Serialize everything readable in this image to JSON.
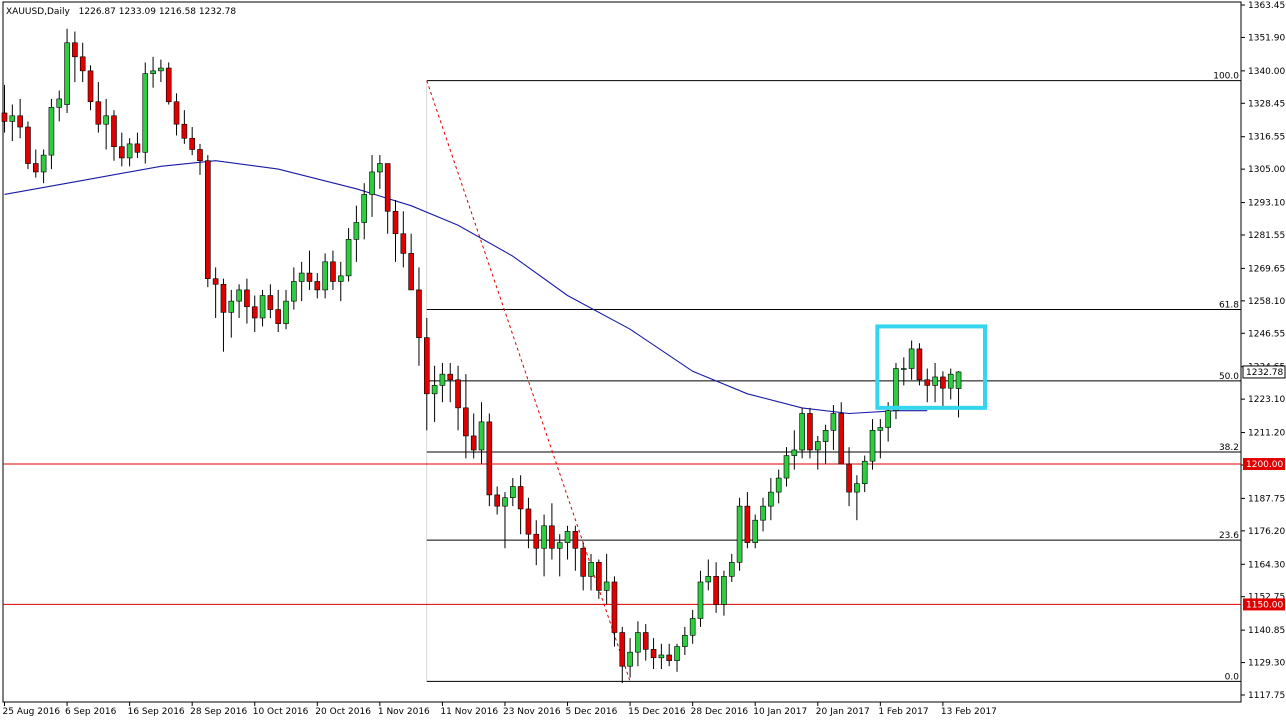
{
  "header": {
    "symbol": "XAUUSD,Daily",
    "ohlc": "1226.87 1233.09 1216.58 1232.78"
  },
  "colors": {
    "bull": "#2ecc40",
    "bear": "#e00000",
    "wick": "#000000",
    "ma": "#1a1aa6",
    "hline_red": "#e00000",
    "fib_line": "#000000",
    "fib_trend": "#e00000",
    "box": "#33d6ee",
    "price_tag_bg": "#ffffff",
    "red_tag_bg": "#e00000"
  },
  "chart_data": {
    "type": "candlestick",
    "symbol": "XAUUSD",
    "timeframe": "Daily",
    "ylim": [
      1117.75,
      1363.45
    ],
    "y_ticks": [
      "1363.45",
      "1351.90",
      "1340.00",
      "1328.45",
      "1316.55",
      "1305.00",
      "1293.10",
      "1281.55",
      "1269.65",
      "1258.10",
      "1246.55",
      "1234.65",
      "1223.10",
      "1211.20",
      "1199.65",
      "1187.75",
      "1176.20",
      "1164.30",
      "1152.75",
      "1140.85",
      "1129.30",
      "1117.75"
    ],
    "x_labels": [
      "25 Aug 2016",
      "6 Sep 2016",
      "16 Sep 2016",
      "28 Sep 2016",
      "10 Oct 2016",
      "20 Oct 2016",
      "1 Nov 2016",
      "11 Nov 2016",
      "23 Nov 2016",
      "5 Dec 2016",
      "15 Dec 2016",
      "28 Dec 2016",
      "10 Jan 2017",
      "20 Jan 2017",
      "1 Feb 2017",
      "13 Feb 2017"
    ],
    "x_label_index": [
      0,
      8,
      16,
      24,
      32,
      40,
      48,
      56,
      64,
      72,
      80,
      88,
      96,
      104,
      112,
      120
    ],
    "candles": [
      [
        1325,
        1335,
        1318,
        1322
      ],
      [
        1322,
        1328,
        1315,
        1324
      ],
      [
        1324,
        1330,
        1316,
        1320
      ],
      [
        1320,
        1322,
        1305,
        1307
      ],
      [
        1307,
        1312,
        1302,
        1304
      ],
      [
        1304,
        1312,
        1300,
        1310
      ],
      [
        1310,
        1330,
        1305,
        1327
      ],
      [
        1327,
        1333,
        1322,
        1330
      ],
      [
        1328,
        1355,
        1325,
        1350
      ],
      [
        1350,
        1354,
        1336,
        1345
      ],
      [
        1345,
        1350,
        1336,
        1340
      ],
      [
        1340,
        1342,
        1326,
        1329
      ],
      [
        1329,
        1336,
        1318,
        1321
      ],
      [
        1321,
        1330,
        1312,
        1324
      ],
      [
        1324,
        1326,
        1308,
        1313
      ],
      [
        1313,
        1318,
        1306,
        1309
      ],
      [
        1309,
        1316,
        1306,
        1314
      ],
      [
        1314,
        1318,
        1309,
        1311
      ],
      [
        1311,
        1343,
        1307,
        1339
      ],
      [
        1339,
        1345,
        1334,
        1340
      ],
      [
        1340,
        1344,
        1336,
        1341
      ],
      [
        1341,
        1343,
        1328,
        1329
      ],
      [
        1329,
        1332,
        1317,
        1321
      ],
      [
        1321,
        1326,
        1314,
        1316
      ],
      [
        1316,
        1320,
        1310,
        1312
      ],
      [
        1312,
        1314,
        1303,
        1308
      ],
      [
        1308,
        1310,
        1263,
        1266
      ],
      [
        1266,
        1270,
        1252,
        1264
      ],
      [
        1264,
        1266,
        1240,
        1254
      ],
      [
        1254,
        1262,
        1245,
        1258
      ],
      [
        1258,
        1264,
        1252,
        1262
      ],
      [
        1262,
        1266,
        1250,
        1256
      ],
      [
        1256,
        1260,
        1247,
        1252
      ],
      [
        1252,
        1262,
        1249,
        1260
      ],
      [
        1260,
        1264,
        1252,
        1255
      ],
      [
        1255,
        1262,
        1247,
        1250
      ],
      [
        1250,
        1262,
        1248,
        1258
      ],
      [
        1258,
        1270,
        1255,
        1265
      ],
      [
        1265,
        1272,
        1258,
        1268
      ],
      [
        1268,
        1276,
        1262,
        1265
      ],
      [
        1265,
        1268,
        1259,
        1262
      ],
      [
        1262,
        1275,
        1259,
        1272
      ],
      [
        1272,
        1276,
        1262,
        1265
      ],
      [
        1265,
        1272,
        1258,
        1267
      ],
      [
        1267,
        1284,
        1265,
        1280
      ],
      [
        1280,
        1292,
        1272,
        1286
      ],
      [
        1286,
        1300,
        1280,
        1296
      ],
      [
        1296,
        1310,
        1288,
        1304
      ],
      [
        1304,
        1310,
        1298,
        1307
      ],
      [
        1307,
        1304,
        1282,
        1290
      ],
      [
        1290,
        1294,
        1272,
        1282
      ],
      [
        1282,
        1290,
        1270,
        1275
      ],
      [
        1275,
        1282,
        1262,
        1262
      ],
      [
        1262,
        1270,
        1235,
        1245
      ],
      [
        1245,
        1252,
        1212,
        1225
      ],
      [
        1225,
        1235,
        1215,
        1228
      ],
      [
        1228,
        1236,
        1222,
        1232
      ],
      [
        1232,
        1236,
        1222,
        1230
      ],
      [
        1230,
        1235,
        1212,
        1220
      ],
      [
        1220,
        1232,
        1202,
        1210
      ],
      [
        1210,
        1218,
        1202,
        1205
      ],
      [
        1205,
        1222,
        1200,
        1215
      ],
      [
        1215,
        1218,
        1185,
        1189
      ],
      [
        1189,
        1192,
        1182,
        1185
      ],
      [
        1185,
        1190,
        1170,
        1188
      ],
      [
        1188,
        1195,
        1185,
        1192
      ],
      [
        1192,
        1196,
        1175,
        1184
      ],
      [
        1184,
        1188,
        1170,
        1175
      ],
      [
        1175,
        1180,
        1164,
        1170
      ],
      [
        1170,
        1182,
        1160,
        1178
      ],
      [
        1178,
        1186,
        1166,
        1170
      ],
      [
        1170,
        1175,
        1160,
        1172
      ],
      [
        1172,
        1178,
        1166,
        1176
      ],
      [
        1176,
        1178,
        1162,
        1170
      ],
      [
        1170,
        1172,
        1155,
        1160
      ],
      [
        1160,
        1168,
        1155,
        1165
      ],
      [
        1165,
        1166,
        1152,
        1155
      ],
      [
        1155,
        1168,
        1150,
        1158
      ],
      [
        1158,
        1160,
        1135,
        1140
      ],
      [
        1140,
        1142,
        1122,
        1128
      ],
      [
        1128,
        1138,
        1124,
        1133
      ],
      [
        1133,
        1144,
        1128,
        1140
      ],
      [
        1140,
        1143,
        1130,
        1134
      ],
      [
        1134,
        1138,
        1127,
        1131
      ],
      [
        1131,
        1136,
        1127,
        1132
      ],
      [
        1132,
        1136,
        1128,
        1130
      ],
      [
        1130,
        1136,
        1126,
        1135
      ],
      [
        1135,
        1142,
        1132,
        1139
      ],
      [
        1139,
        1148,
        1136,
        1145
      ],
      [
        1145,
        1162,
        1142,
        1158
      ],
      [
        1158,
        1166,
        1155,
        1160
      ],
      [
        1160,
        1165,
        1147,
        1150
      ],
      [
        1150,
        1162,
        1146,
        1160
      ],
      [
        1160,
        1168,
        1158,
        1165
      ],
      [
        1165,
        1188,
        1162,
        1185
      ],
      [
        1185,
        1190,
        1170,
        1172
      ],
      [
        1172,
        1182,
        1170,
        1180
      ],
      [
        1180,
        1188,
        1176,
        1185
      ],
      [
        1185,
        1195,
        1180,
        1190
      ],
      [
        1190,
        1198,
        1186,
        1195
      ],
      [
        1195,
        1206,
        1192,
        1203
      ],
      [
        1203,
        1212,
        1198,
        1205
      ],
      [
        1205,
        1220,
        1202,
        1218
      ],
      [
        1218,
        1220,
        1202,
        1205
      ],
      [
        1205,
        1210,
        1198,
        1208
      ],
      [
        1208,
        1214,
        1200,
        1212
      ],
      [
        1212,
        1221,
        1205,
        1218
      ],
      [
        1218,
        1222,
        1200,
        1200
      ],
      [
        1200,
        1206,
        1185,
        1190
      ],
      [
        1190,
        1196,
        1180,
        1193
      ],
      [
        1193,
        1203,
        1190,
        1201
      ],
      [
        1201,
        1216,
        1198,
        1212
      ],
      [
        1212,
        1216,
        1202,
        1213
      ],
      [
        1213,
        1222,
        1208,
        1219
      ],
      [
        1219,
        1236,
        1216,
        1234
      ],
      [
        1234,
        1238,
        1228,
        1234
      ],
      [
        1234,
        1244,
        1230,
        1241
      ],
      [
        1241,
        1243,
        1228,
        1230
      ],
      [
        1230,
        1234,
        1222,
        1228
      ],
      [
        1228,
        1236,
        1222,
        1231
      ],
      [
        1231,
        1233,
        1220,
        1227
      ],
      [
        1227,
        1234,
        1223,
        1232
      ],
      [
        1226.87,
        1233.09,
        1216.58,
        1232.78
      ]
    ],
    "ma_points": [
      [
        0,
        1296
      ],
      [
        10,
        1301
      ],
      [
        20,
        1306
      ],
      [
        27,
        1308
      ],
      [
        35,
        1305
      ],
      [
        45,
        1298
      ],
      [
        52,
        1292
      ],
      [
        58,
        1285
      ],
      [
        65,
        1274
      ],
      [
        72,
        1260
      ],
      [
        80,
        1248
      ],
      [
        88,
        1233
      ],
      [
        95,
        1225
      ],
      [
        102,
        1220
      ],
      [
        108,
        1218
      ],
      [
        114,
        1219
      ],
      [
        118,
        1219
      ]
    ],
    "fib": {
      "start_index": 54,
      "trend_from": [
        54,
        1336.5
      ],
      "trend_to": [
        80,
        1122.6
      ],
      "levels": [
        {
          "label": "100.0",
          "price": 1336.5
        },
        {
          "label": "61.8",
          "price": 1255.0
        },
        {
          "label": "50.0",
          "price": 1229.6
        },
        {
          "label": "38.2",
          "price": 1204.3
        },
        {
          "label": "23.6",
          "price": 1172.9
        },
        {
          "label": "0.0",
          "price": 1122.6
        }
      ]
    },
    "horizontal_levels": [
      {
        "label": "1200.00",
        "price": 1200.0
      },
      {
        "label": "1150.00",
        "price": 1150.0
      }
    ],
    "current_price_tag": {
      "label": "1232.78",
      "price": 1232.78
    },
    "highlight_box": {
      "from_index": 112,
      "to_index": 125,
      "price_high": 1249,
      "price_low": 1220
    }
  }
}
